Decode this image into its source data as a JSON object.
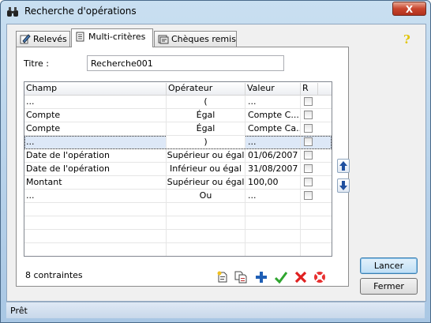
{
  "window": {
    "title": "Recherche d'opérations",
    "close_label": "X"
  },
  "tabs": [
    {
      "label": "Relevés",
      "icon": "edit-icon",
      "active": false
    },
    {
      "label": "Multi-critères",
      "icon": "document-icon",
      "active": true
    },
    {
      "label": "Chèques remis",
      "icon": "cheque-icon",
      "active": false
    }
  ],
  "help_label": "?",
  "form": {
    "titre_label": "Titre :",
    "titre_value": "Recherche001"
  },
  "grid": {
    "headers": {
      "champ": "Champ",
      "operateur": "Opérateur",
      "valeur": "Valeur",
      "r": "R"
    },
    "rows": [
      {
        "champ": "...",
        "operateur": "(",
        "valeur": "...",
        "r": false
      },
      {
        "champ": "Compte",
        "operateur": "Égal",
        "valeur": "Compte C...",
        "r": false
      },
      {
        "champ": "Compte",
        "operateur": "Égal",
        "valeur": "Compte Ca...",
        "r": false
      },
      {
        "champ": "...",
        "operateur": ")",
        "valeur": "...",
        "r": false,
        "selected": true
      },
      {
        "champ": "Date de l'opération",
        "operateur": "Supérieur ou égal",
        "valeur": "01/06/2007",
        "r": false
      },
      {
        "champ": "Date de l'opération",
        "operateur": "Inférieur ou égal",
        "valeur": "31/08/2007",
        "r": false
      },
      {
        "champ": "Montant",
        "operateur": "Supérieur ou égal",
        "valeur": "100,00",
        "r": false
      },
      {
        "champ": "...",
        "operateur": "Ou",
        "valeur": "...",
        "r": false
      }
    ]
  },
  "count_label": "8 contraintes",
  "buttons": {
    "lancer": "Lancer",
    "fermer": "Fermer"
  },
  "status": {
    "text": "Prêt"
  },
  "colors": {
    "accent": "#1f5fb5",
    "selection": "#dde8f7",
    "check": "#2fa52f",
    "delete": "#e02020"
  }
}
